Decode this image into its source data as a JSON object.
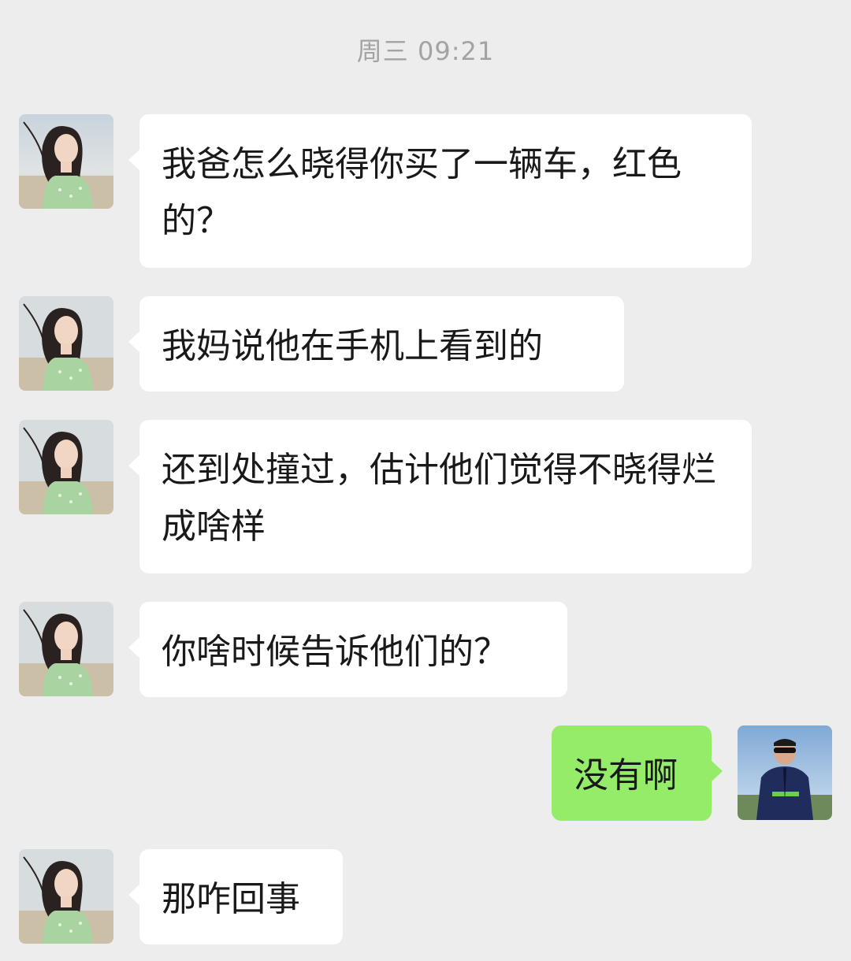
{
  "timestamp": "周三 09:21",
  "messages": [
    {
      "sender": "other",
      "text": "我爸怎么晓得你买了一辆车，红色的？"
    },
    {
      "sender": "other",
      "text": "我妈说他在手机上看到的"
    },
    {
      "sender": "other",
      "text": "还到处撞过，估计他们觉得不晓得烂成啥样"
    },
    {
      "sender": "other",
      "text": "你啥时候告诉他们的？"
    },
    {
      "sender": "me",
      "text": "没有啊"
    },
    {
      "sender": "other",
      "text": "那咋回事"
    }
  ],
  "colors": {
    "background": "#ededed",
    "incoming_bubble": "#ffffff",
    "outgoing_bubble": "#95ec69",
    "timestamp": "#a3a3a3",
    "text": "#191919"
  },
  "icons": {
    "contact_avatar": "avatar-woman-beach-photo",
    "self_avatar": "avatar-man-sunglasses-photo"
  }
}
